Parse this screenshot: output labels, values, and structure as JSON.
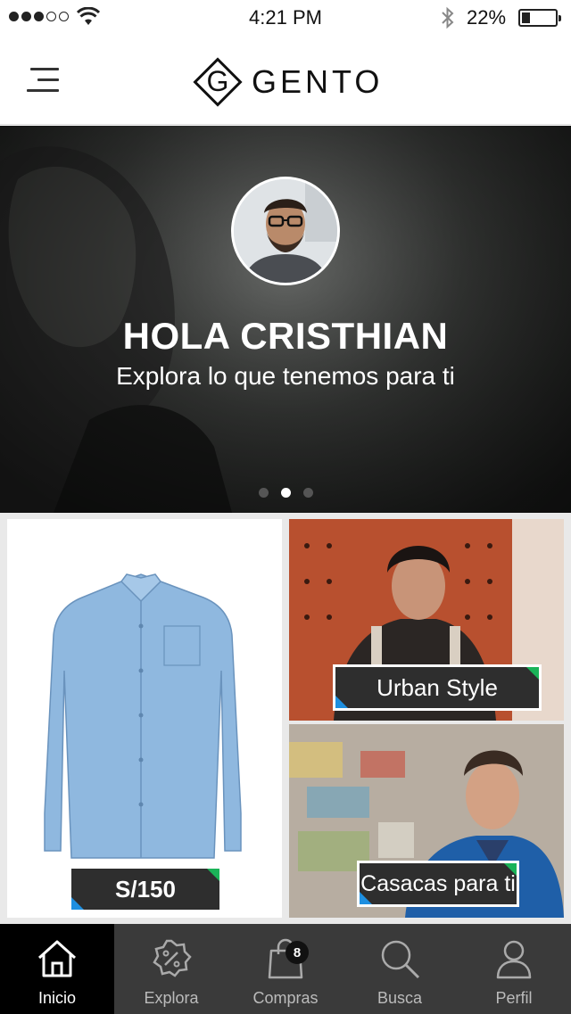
{
  "status_bar": {
    "time": "4:21 PM",
    "battery_percent": "22%",
    "battery_level": 0.22,
    "signal_bars_filled": 3,
    "signal_bars_total": 5,
    "icons": [
      "signal-dots-icon",
      "wifi-icon",
      "bluetooth-icon",
      "battery-icon"
    ]
  },
  "header": {
    "logo_letter": "G",
    "logo_text": "GENTO",
    "menu_icon": "hamburger-icon"
  },
  "hero": {
    "greeting": "HOLA CRISTHIAN",
    "subtitle": "Explora lo que tenemos para ti",
    "slides_total": 3,
    "active_slide": 2
  },
  "grid": {
    "product": {
      "price": "S/150",
      "image": "blue-shirt"
    },
    "urban": {
      "label": "Urban Style"
    },
    "casacas": {
      "label": "Casacas para ti"
    },
    "colors": {
      "tag_bg": "#2e2e2e",
      "corner_green": "#1ab358",
      "corner_blue": "#1e8fe0"
    }
  },
  "tabs": [
    {
      "label": "Inicio",
      "icon": "home-icon",
      "active": true
    },
    {
      "label": "Explora",
      "icon": "discount-badge-icon",
      "active": false
    },
    {
      "label": "Compras",
      "icon": "shopping-bag-icon",
      "active": false
    },
    {
      "label": "Busca",
      "icon": "search-icon",
      "active": false
    },
    {
      "label": "Perfil",
      "icon": "user-icon",
      "active": false
    }
  ],
  "cart_badge": "8"
}
